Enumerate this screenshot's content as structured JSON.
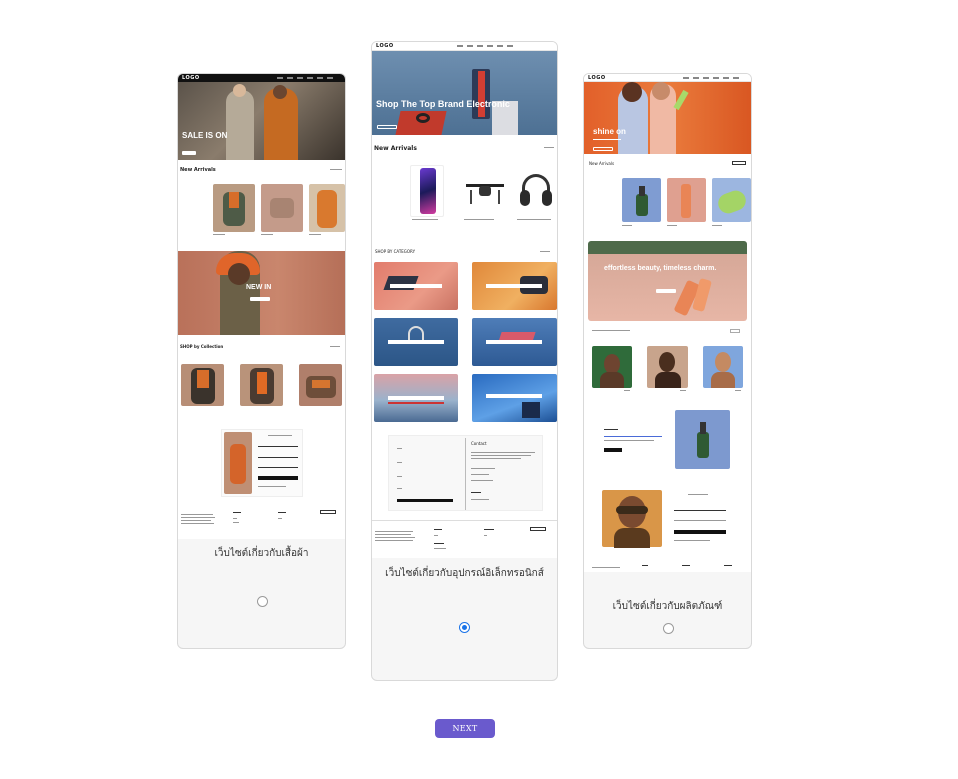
{
  "options": [
    {
      "label": "เว็บไซต์เกี่ยวกับเสื้อผ้า",
      "selected": false,
      "preview": {
        "logo": "LOGO",
        "hero_title": "SALE IS ON",
        "section_new_arrivals": "New Arrivals",
        "banner_title": "NEW IN",
        "section_2": "SHOP by Collection"
      }
    },
    {
      "label": "เว็บไซต์เกี่ยวกับอุปกรณ์อิเล็กทรอนิกส์",
      "selected": true,
      "preview": {
        "logo": "LOGO",
        "hero_title": "Shop The Top Brand Electronic",
        "section_new_arrivals": "New Arrivals",
        "section_2": "SHOP BY CATEGORY",
        "contact_title": "Contact"
      }
    },
    {
      "label": "เว็บไซต์เกี่ยวกับผลิตภัณฑ์",
      "selected": false,
      "preview": {
        "logo": "LOGO",
        "hero_title": "shine on",
        "section_new_arrivals": "New Arrivals",
        "banner_title": "effortless beauty, timeless charm."
      }
    }
  ],
  "next_label": "NEXT",
  "colors": {
    "accent": "#6a5acd",
    "radio_selected": "#1a73e8"
  }
}
